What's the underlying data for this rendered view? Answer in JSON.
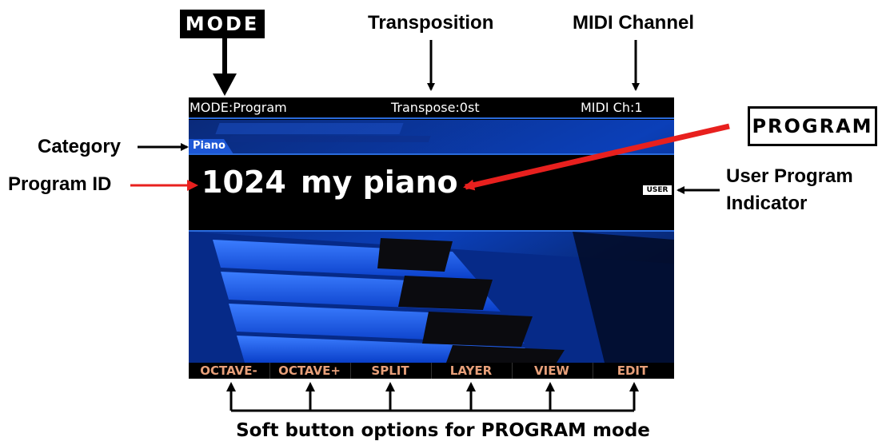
{
  "callouts": {
    "mode": "MODE",
    "transposition": "Transposition",
    "midi_channel": "MIDI Channel",
    "program": "PROGRAM",
    "category": "Category",
    "program_id": "Program ID",
    "user_program_indicator_line1": "User Program",
    "user_program_indicator_line2": "Indicator",
    "soft_buttons_caption": "Soft button options for PROGRAM mode"
  },
  "screen": {
    "status": {
      "mode": "MODE:Program",
      "transpose": "Transpose:0st",
      "midi_channel": "MIDI Ch:1"
    },
    "category_tab": "Piano",
    "program_id": "1024",
    "program_name": "my piano",
    "user_badge": "USER",
    "soft_buttons": [
      "OCTAVE-",
      "OCTAVE+",
      "SPLIT",
      "LAYER",
      "VIEW",
      "EDIT"
    ]
  },
  "colors": {
    "screen_accent": "#2a6bdc",
    "soft_button_text": "#e8a07a",
    "red_arrow": "#e8201e"
  }
}
